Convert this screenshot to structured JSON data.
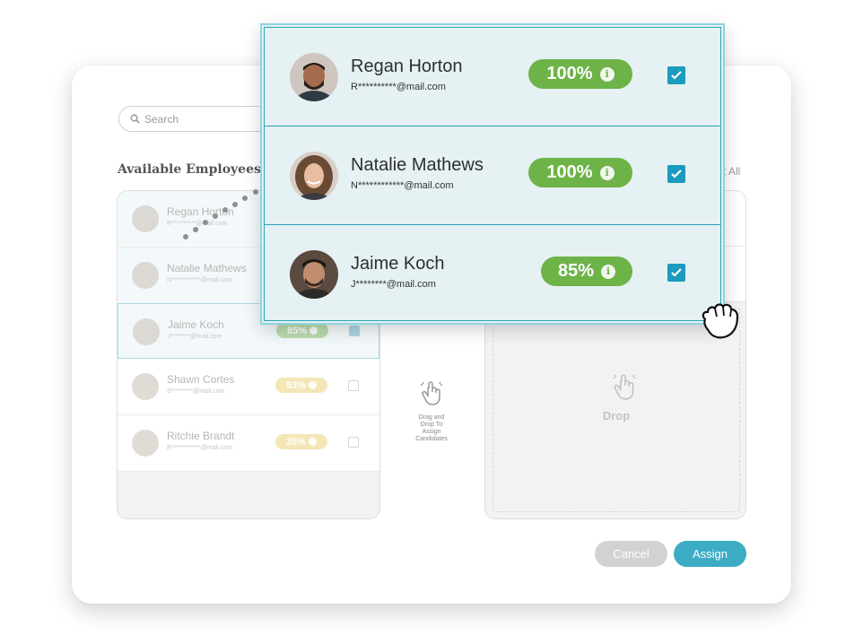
{
  "search": {
    "placeholder": "Search"
  },
  "available_title": "Available Employees",
  "select_all": "t All",
  "hint": {
    "line1": "Drag and",
    "line2": "Drop To",
    "line3": "Assign",
    "line4": "Candidates"
  },
  "drop_label": "Drop",
  "buttons": {
    "cancel": "Cancel",
    "assign": "Assign"
  },
  "left_list": [
    {
      "name": "Regan Horton",
      "email": "R**********@mail.com",
      "score": "",
      "checked": true
    },
    {
      "name": "Natalie Mathews",
      "email": "N************@mail.com",
      "score": "",
      "checked": true
    },
    {
      "name": "Jaime Koch",
      "email": "J********@mail.com",
      "score": "85%",
      "checked": true
    },
    {
      "name": "Shawn Cortes",
      "email": "S*********@mail.com",
      "score": "53%",
      "checked": false
    },
    {
      "name": "Ritchie Brandt",
      "email": "R************@mail.com",
      "score": "35%",
      "checked": false
    }
  ],
  "dragged": [
    {
      "name": "Regan Horton",
      "email": "R**********@mail.com",
      "score": "100%",
      "checked": true
    },
    {
      "name": "Natalie Mathews",
      "email": "N************@mail.com",
      "score": "100%",
      "checked": true
    },
    {
      "name": "Jaime Koch",
      "email": "J********@mail.com",
      "score": "85%",
      "checked": true
    }
  ],
  "colors": {
    "accent": "#3bacc4",
    "score_green": "#6db348",
    "score_yellow": "#f5e6b7",
    "checkbox": "#1b9bbd",
    "overlay_bg": "#e5f1f3"
  },
  "icons": [
    "search-icon",
    "info-icon",
    "check-icon",
    "drag-hand-icon",
    "grab-hand-icon"
  ]
}
